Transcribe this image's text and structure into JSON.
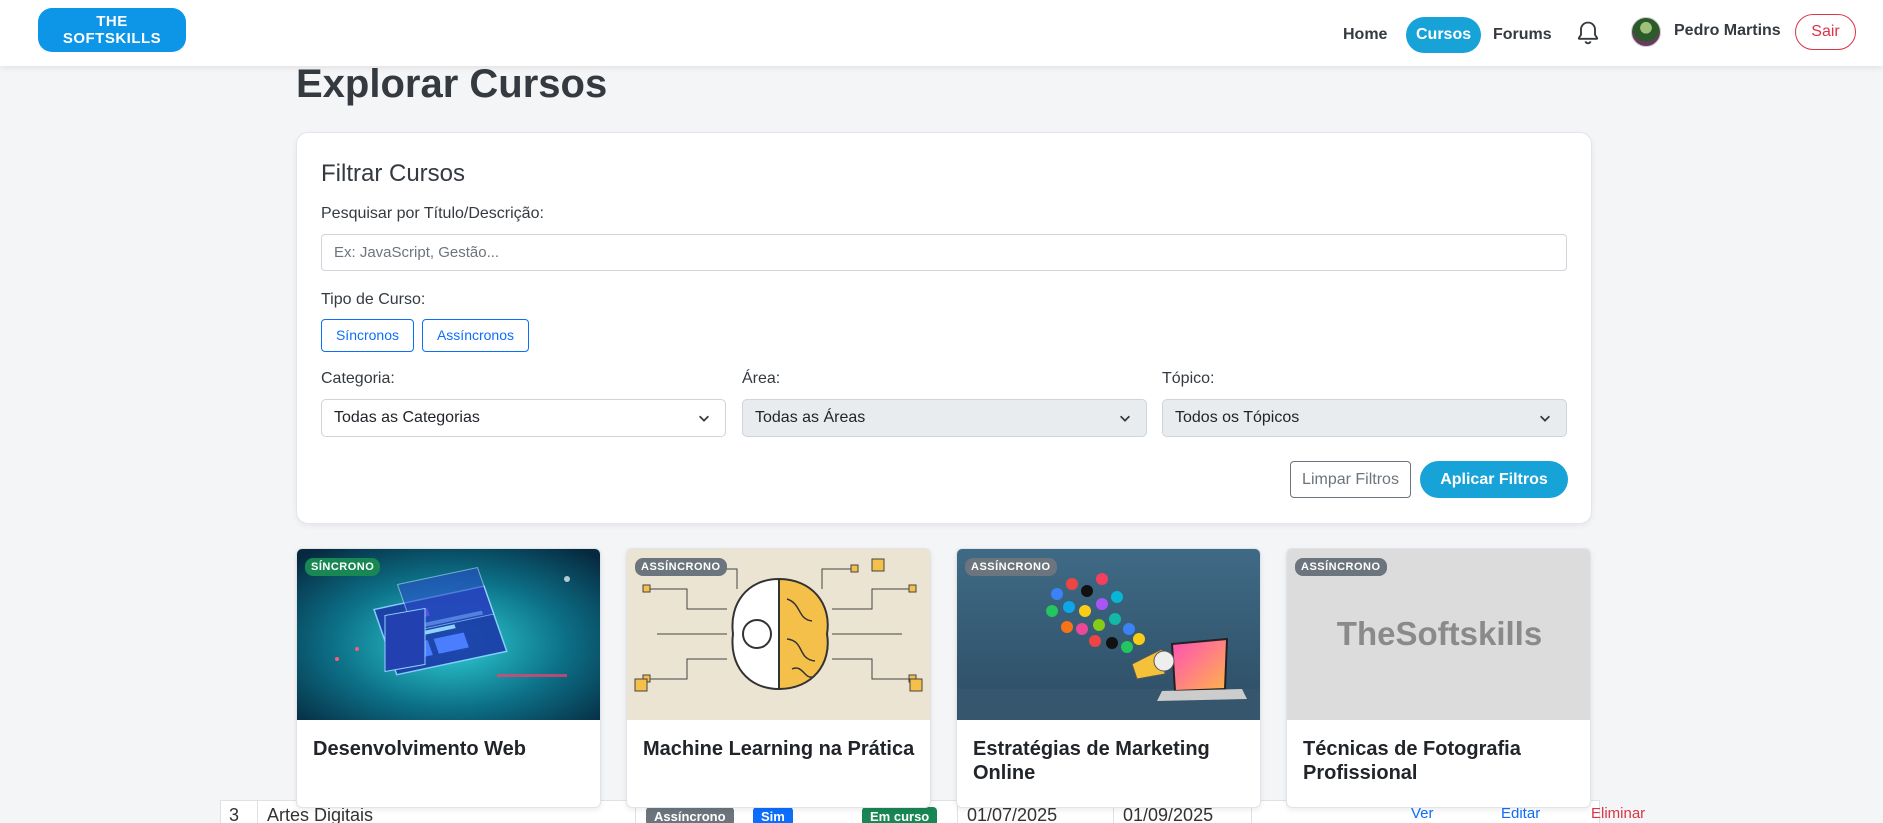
{
  "nav": {
    "logo_line1": "THE",
    "logo_line2": "SOFTSKILLS",
    "links": [
      {
        "label": "Home"
      },
      {
        "label": "Cursos",
        "active": true
      },
      {
        "label": "Forums"
      }
    ],
    "user_name": "Pedro Martins",
    "logout_label": "Sair"
  },
  "page": {
    "title": "Explorar Cursos"
  },
  "filters": {
    "title": "Filtrar Cursos",
    "search_label": "Pesquisar por Título/Descrição:",
    "search_placeholder": "Ex: JavaScript, Gestão...",
    "search_value": "",
    "type_label": "Tipo de Curso:",
    "type_options": [
      "Síncronos",
      "Assíncronos"
    ],
    "category_label": "Categoria:",
    "category_value": "Todas as Categorias",
    "area_label": "Área:",
    "area_value": "Todas as Áreas",
    "topic_label": "Tópico:",
    "topic_value": "Todos os Tópicos",
    "clear_label": "Limpar Filtros",
    "apply_label": "Aplicar Filtros"
  },
  "courses": [
    {
      "badge": "SÍNCRONO",
      "title": "Desenvolvimento Web"
    },
    {
      "badge": "ASSÍNCRONO",
      "title": "Machine Learning na Prática"
    },
    {
      "badge": "ASSÍNCRONO",
      "title": "Estratégias de Marketing Online"
    },
    {
      "badge": "ASSÍNCRONO",
      "title": "Técnicas de Fotografia Profissional",
      "placeholder_text": "TheSoftskills"
    }
  ],
  "background_row": {
    "index": "3",
    "name": "Artes Digitais",
    "type": "Assíncrono",
    "flag": "Sim",
    "status": "Em curso",
    "start": "01/07/2025",
    "end": "01/09/2025",
    "view": "Ver",
    "edit": "Editar",
    "delete": "Eliminar"
  },
  "colors": {
    "primary": "#17a2d8",
    "logo": "#0d95e8",
    "danger": "#dc3545",
    "sync_badge": "#198754",
    "async_badge": "#6c757d"
  }
}
